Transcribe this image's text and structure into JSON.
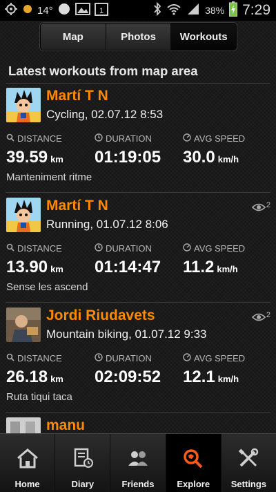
{
  "status_bar": {
    "temperature": "14°",
    "battery_percent": "38%",
    "time": "7:29",
    "icons": [
      "gps-icon",
      "weather-icon",
      "gallery-icon",
      "calendar-icon",
      "bluetooth-icon",
      "wifi-icon",
      "signal-icon",
      "battery-charging-icon"
    ]
  },
  "tabs": [
    {
      "label": "Map",
      "selected": false
    },
    {
      "label": "Photos",
      "selected": false
    },
    {
      "label": "Workouts",
      "selected": true
    }
  ],
  "section_title": "Latest workouts from map area",
  "stat_labels": {
    "distance": "DISTANCE",
    "duration": "DURATION",
    "avg_speed": "AVG SPEED"
  },
  "workouts": [
    {
      "user": "Martí T N",
      "activity": "Cycling, 02.07.12 8:53",
      "distance": "39.59",
      "distance_unit": "km",
      "duration": "01:19:05",
      "avg_speed": "30.0",
      "speed_unit": "km/h",
      "note": "Manteniment ritme",
      "views": ""
    },
    {
      "user": "Martí T N",
      "activity": "Running, 01.07.12 8:06",
      "distance": "13.90",
      "distance_unit": "km",
      "duration": "01:14:47",
      "avg_speed": "11.2",
      "speed_unit": "km/h",
      "note": "Sense les ascend",
      "views": "2"
    },
    {
      "user": "Jordi Riudavets",
      "activity": "Mountain biking, 01.07.12 9:33",
      "distance": "26.18",
      "distance_unit": "km",
      "duration": "02:09:52",
      "avg_speed": "12.1",
      "speed_unit": "km/h",
      "note": "Ruta tiqui taca",
      "views": "2"
    },
    {
      "user": "manu"
    }
  ],
  "bottom_nav": [
    {
      "label": "Home",
      "icon": "home-icon",
      "active": false
    },
    {
      "label": "Diary",
      "icon": "diary-icon",
      "active": false
    },
    {
      "label": "Friends",
      "icon": "friends-icon",
      "active": false
    },
    {
      "label": "Explore",
      "icon": "explore-icon",
      "active": true
    },
    {
      "label": "Settings",
      "icon": "settings-icon",
      "active": false
    }
  ],
  "colors": {
    "accent": "#ff8a00",
    "background": "#161616",
    "text": "#ffffff"
  }
}
